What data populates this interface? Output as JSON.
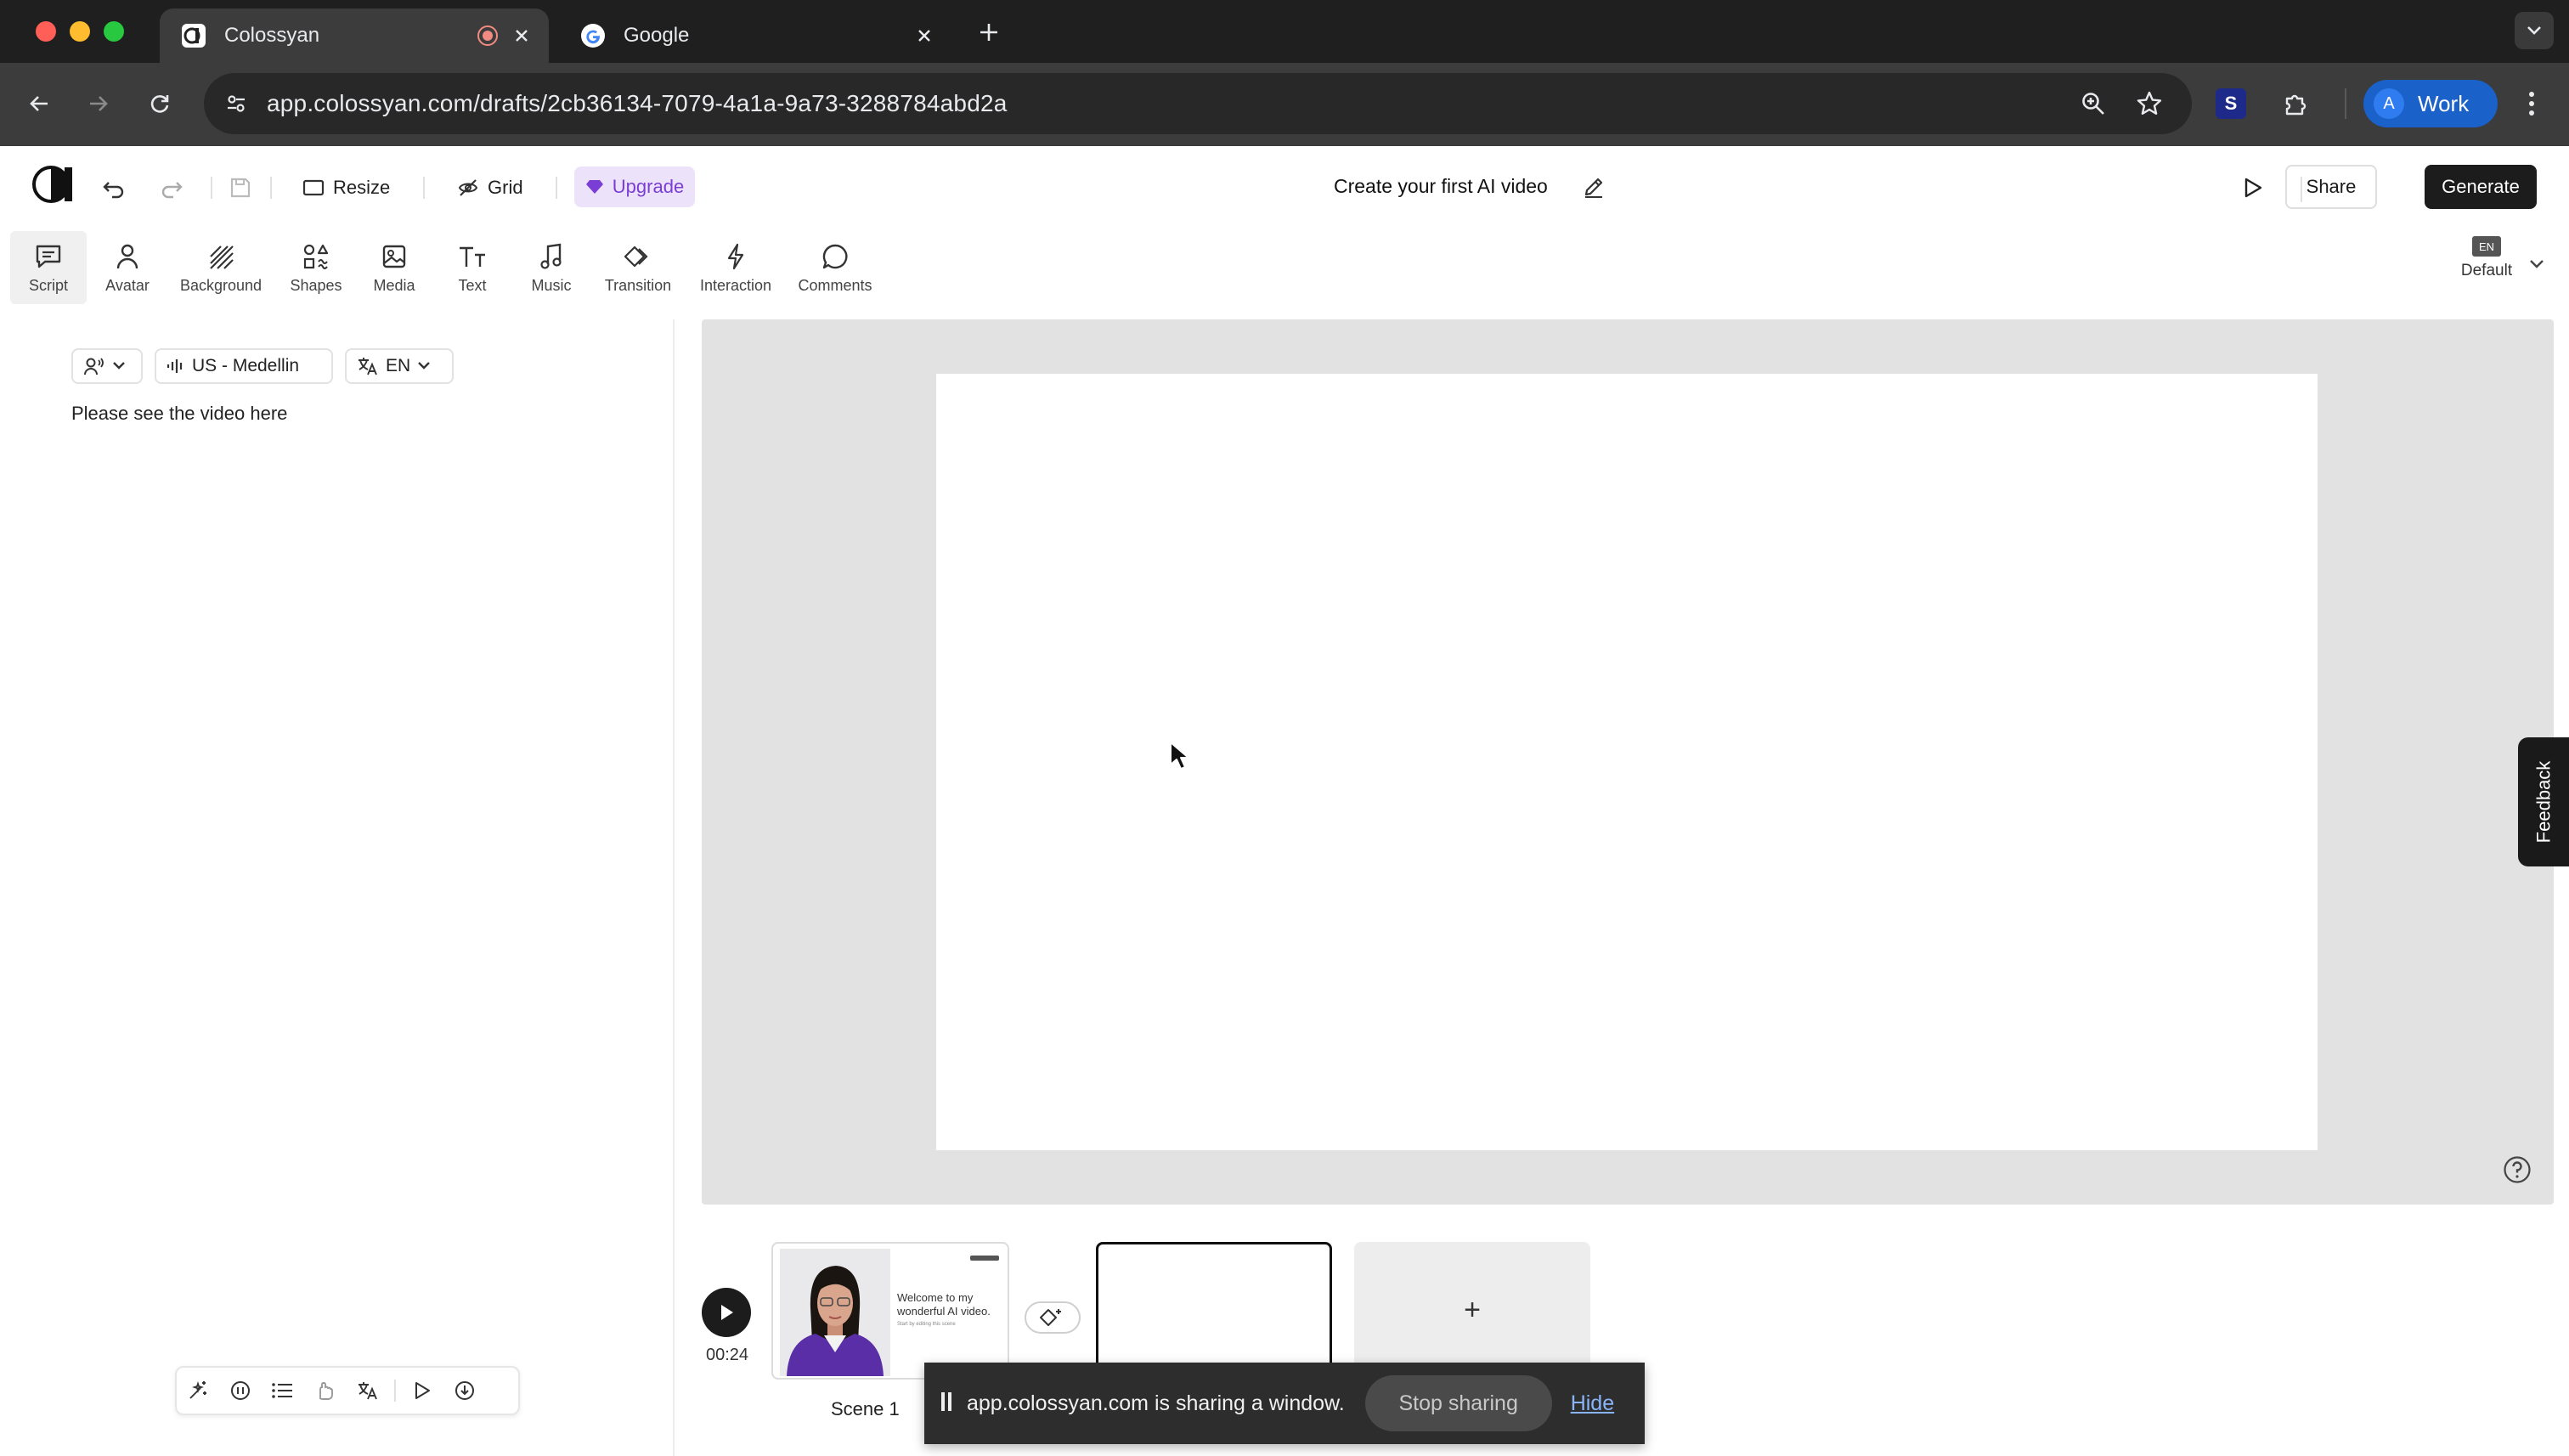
{
  "browser": {
    "tabs": [
      {
        "title": "Colossyan",
        "active": true
      },
      {
        "title": "Google",
        "active": false
      }
    ],
    "url": "app.colossyan.com/drafts/2cb36134-7079-4a1a-9a73-3288784abd2a",
    "profile": {
      "initial": "A",
      "label": "Work"
    },
    "extension_letter": "S"
  },
  "header": {
    "resize_label": "Resize",
    "grid_label": "Grid",
    "upgrade_label": "Upgrade",
    "project_title": "Create your first AI video",
    "share_label": "Share",
    "generate_label": "Generate"
  },
  "tools": [
    {
      "label": "Script",
      "icon": "script-icon"
    },
    {
      "label": "Avatar",
      "icon": "avatar-icon"
    },
    {
      "label": "Background",
      "icon": "background-icon"
    },
    {
      "label": "Shapes",
      "icon": "shapes-icon"
    },
    {
      "label": "Media",
      "icon": "media-icon"
    },
    {
      "label": "Text",
      "icon": "text-icon"
    },
    {
      "label": "Music",
      "icon": "music-icon"
    },
    {
      "label": "Transition",
      "icon": "transition-icon"
    },
    {
      "label": "Interaction",
      "icon": "interaction-icon"
    },
    {
      "label": "Comments",
      "icon": "comments-icon"
    }
  ],
  "language_selector": {
    "flag": "EN",
    "label": "Default"
  },
  "script_panel": {
    "voice": "US - Medellin",
    "language": "EN",
    "text": "Please see the video here"
  },
  "timeline": {
    "total_time": "00:24",
    "scenes": [
      {
        "label": "Scene 1",
        "thumb_text": "Welcome to my wonderful AI video.",
        "thumb_subtext": "Start by editing this scene"
      }
    ],
    "add_scene": "+"
  },
  "feedback_label": "Feedback",
  "sharing_bar": {
    "message": "app.colossyan.com is sharing a window.",
    "stop_label": "Stop sharing",
    "hide_label": "Hide"
  },
  "colors": {
    "accent_purple": "#7a3ed4",
    "upgrade_bg": "#ece3fb",
    "generate_bg": "#1c1c1c",
    "profile_blue": "#1a61c9"
  }
}
